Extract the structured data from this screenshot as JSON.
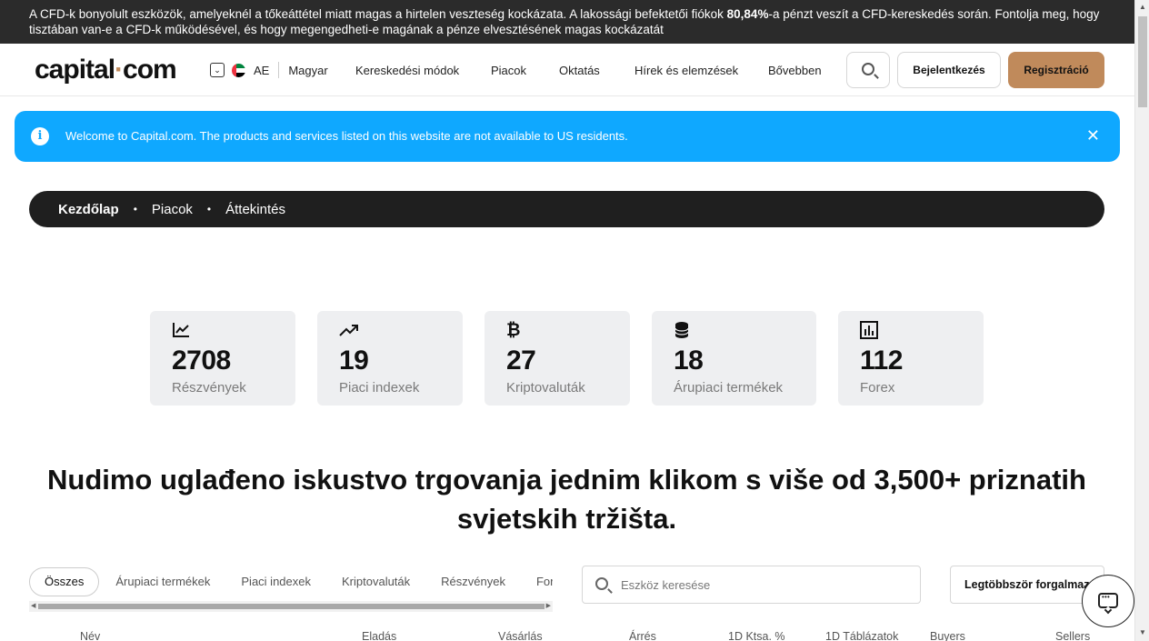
{
  "risk_banner": {
    "text_before": "A CFD-k bonyolult eszközök, amelyeknél a tőkeáttétel miatt magas a hirtelen veszteség kockázata. A lakossági befektetői fiókok ",
    "percent": "80,84%",
    "text_after": "-a pénzt veszít a CFD-kereskedés során. Fontolja meg, hogy tisztában van-e a CFD-k működésével, és hogy megengedheti-e magának a pénze elvesztésének magas kockázatát"
  },
  "header": {
    "logo_left": "capital",
    "logo_dot": "·",
    "logo_right": "com",
    "region_code": "AE",
    "language": "Magyar",
    "nav": [
      "Kereskedési módok",
      "Piacok",
      "Oktatás",
      "Hírek és elemzések",
      "Bővebben"
    ],
    "login": "Bejelentkezés",
    "register": "Regisztráció"
  },
  "notice": {
    "text": "Welcome to Capital.com. The products and services listed on this website are not available to US residents.",
    "close": "✕"
  },
  "breadcrumb": [
    "Kezdőlap",
    "Piacok",
    "Áttekintés"
  ],
  "stats": [
    {
      "icon": "line-chart-icon",
      "value": "2708",
      "label": "Részvények"
    },
    {
      "icon": "trending-up-icon",
      "value": "19",
      "label": "Piaci indexek"
    },
    {
      "icon": "bitcoin-icon",
      "value": "27",
      "label": "Kriptovaluták"
    },
    {
      "icon": "coins-stack-icon",
      "value": "18",
      "label": "Árupiaci termékek"
    },
    {
      "icon": "bar-chart-icon",
      "value": "112",
      "label": "Forex"
    }
  ],
  "headline": "Nudimo uglađeno iskustvo trgovanja jednim klikom s više od 3,500+ priznatih svjetskih tržišta.",
  "tabs": [
    "Összes",
    "Árupiaci termékek",
    "Piaci indexek",
    "Kriptovaluták",
    "Részvények",
    "Forex"
  ],
  "asset_search": {
    "placeholder": "Eszköz keresése"
  },
  "sort": {
    "label": "Legtöbbször forgalmazott"
  },
  "table_headers": [
    "Név",
    "Eladás",
    "Vásárlás",
    "Árrés",
    "1D Ktsa. %",
    "1D Táblázatok",
    "Buyers",
    "Sellers"
  ],
  "colors": {
    "brand": "#c08a5b",
    "notice_bg": "#0fa8ff",
    "dark": "#1f1f1f"
  }
}
